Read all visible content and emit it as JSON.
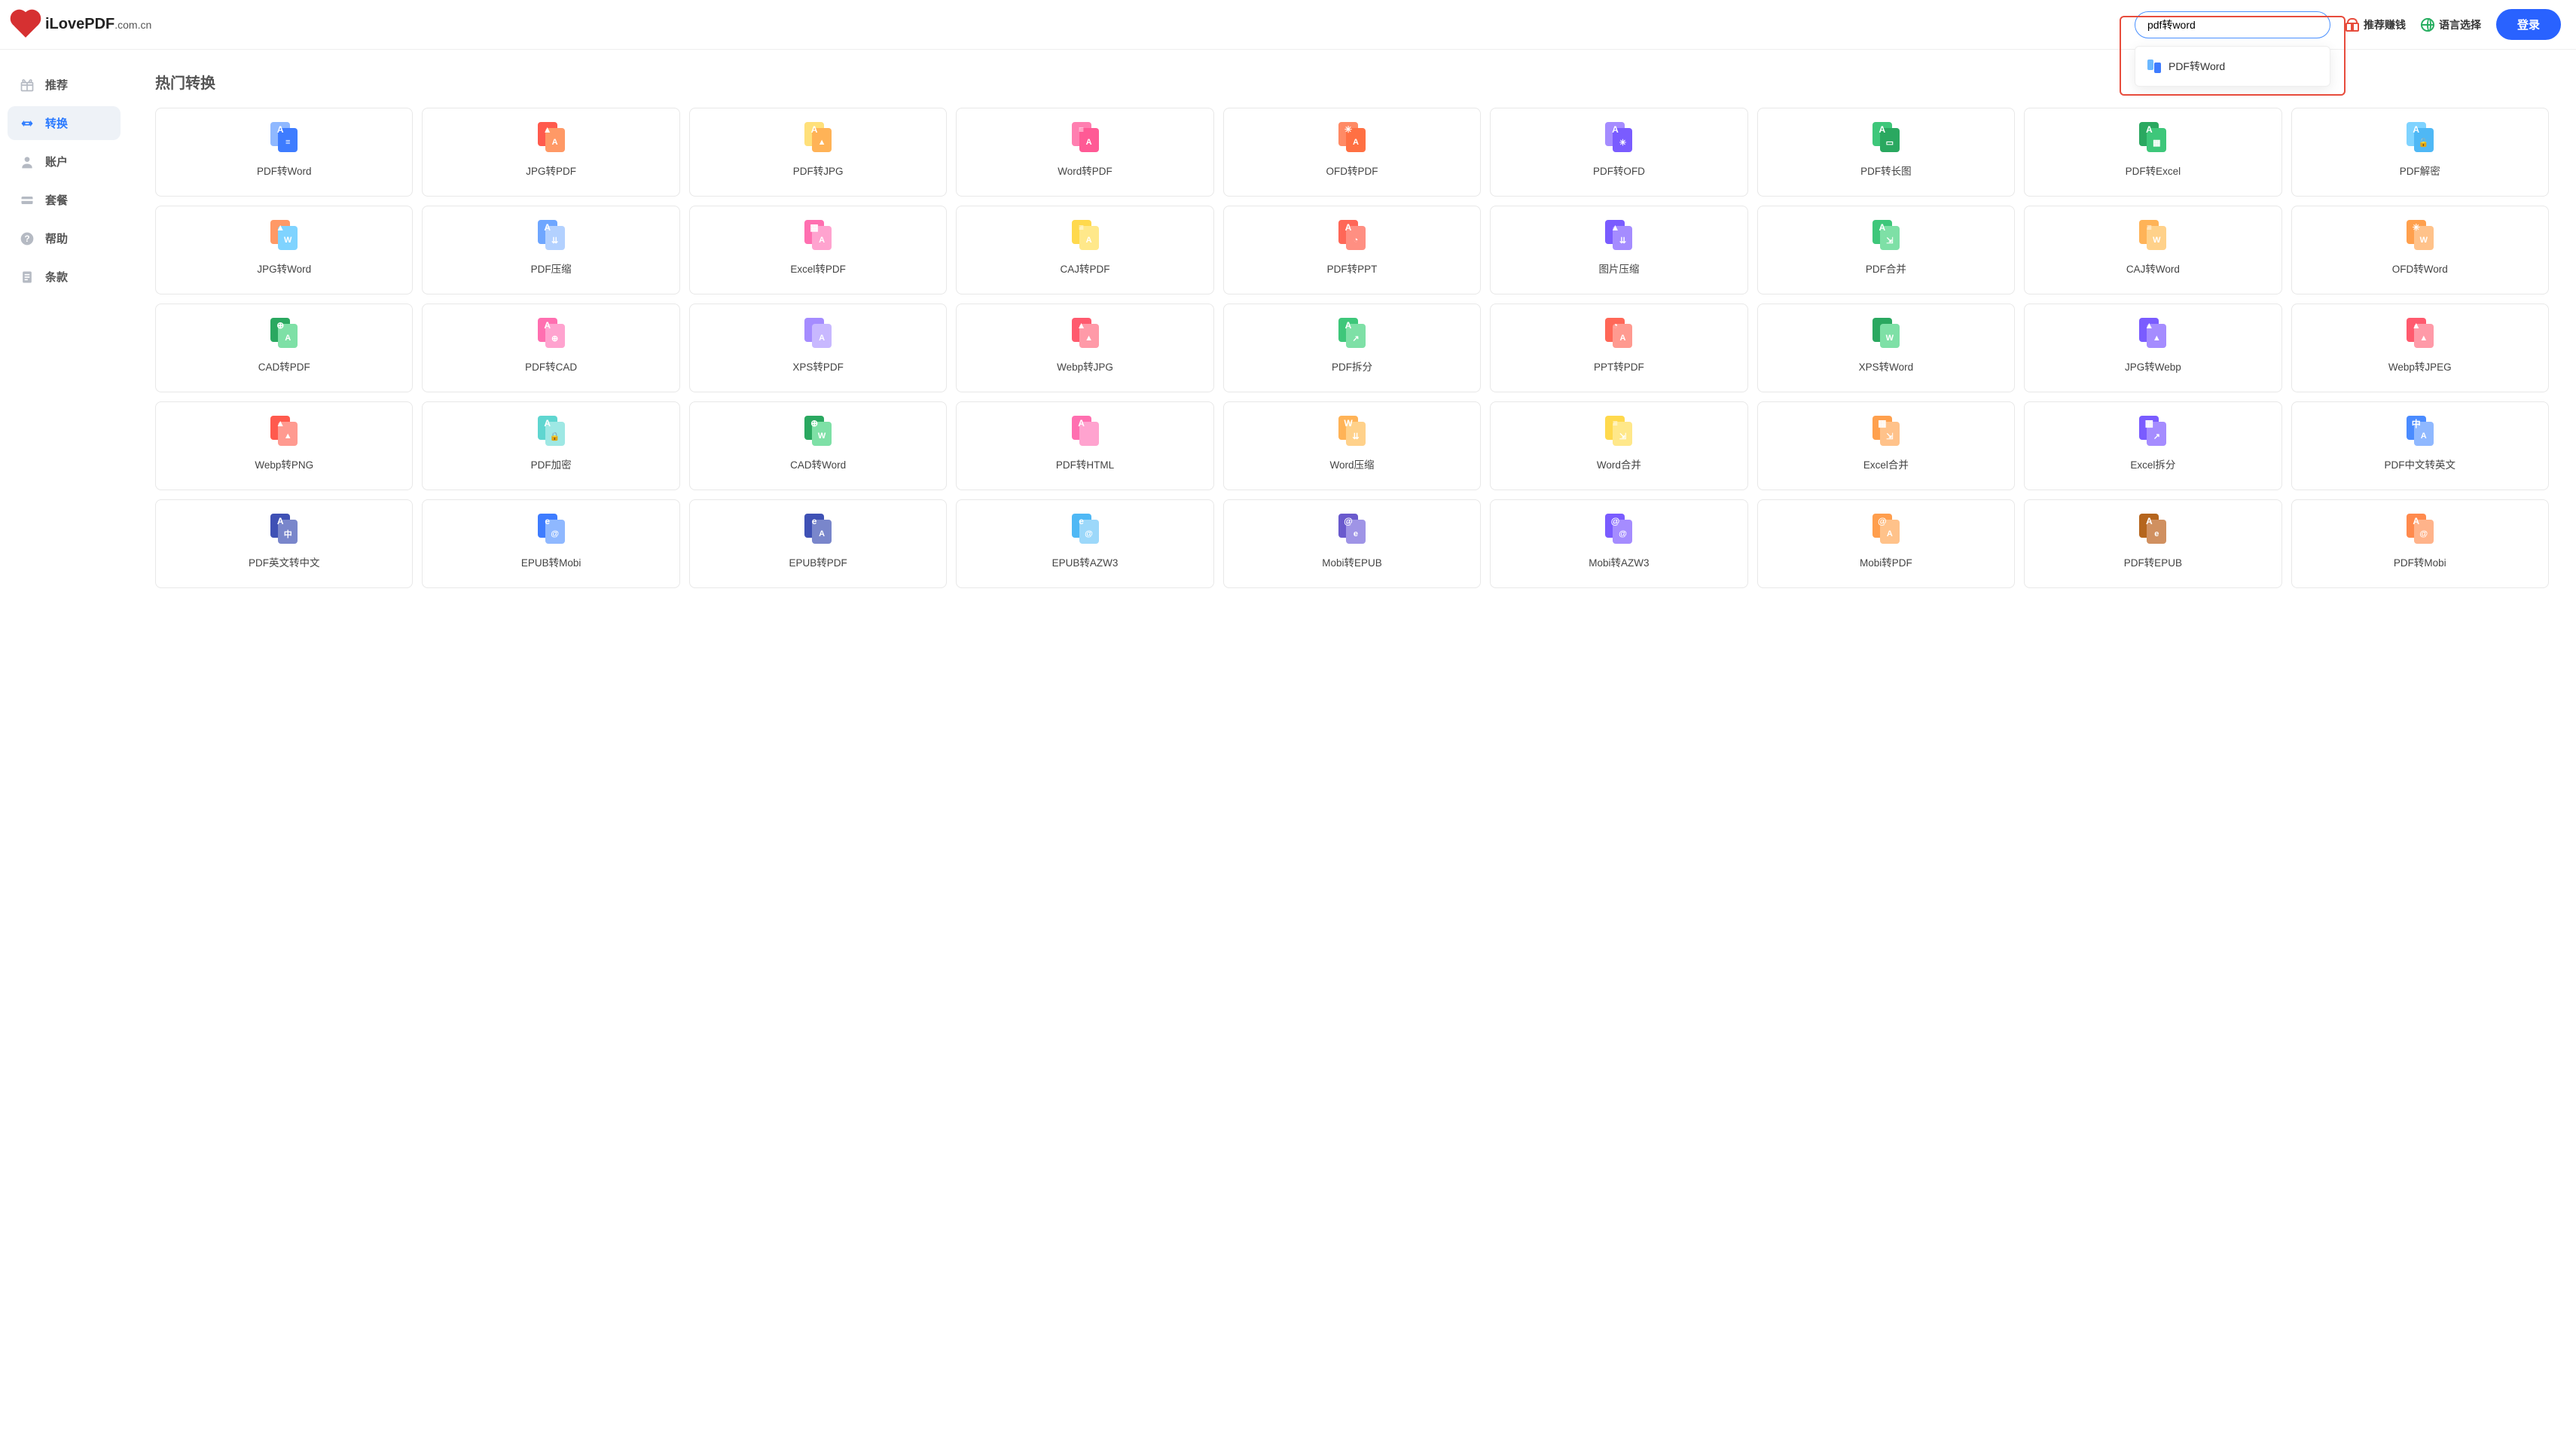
{
  "brand": {
    "name": "iLovePDF",
    "tld": ".com.cn"
  },
  "search": {
    "value": "pdf转word",
    "placeholder": "",
    "suggestion": "PDF转Word"
  },
  "header_links": {
    "recommend_earn": "推荐赚钱",
    "language": "语言选择",
    "login": "登录"
  },
  "sidebar": {
    "items": [
      {
        "label": "推荐",
        "icon": "gift"
      },
      {
        "label": "转换",
        "icon": "swap",
        "active": true
      },
      {
        "label": "账户",
        "icon": "user"
      },
      {
        "label": "套餐",
        "icon": "card"
      },
      {
        "label": "帮助",
        "icon": "help"
      },
      {
        "label": "条款",
        "icon": "doc"
      }
    ]
  },
  "section_title": "热门转换",
  "tools": [
    {
      "label": "PDF转Word",
      "c1": "#8fb8ff",
      "c2": "#3e7cff",
      "g1": "A",
      "g2": "≡"
    },
    {
      "label": "JPG转PDF",
      "c1": "#ff5a4d",
      "c2": "#ff9966",
      "g1": "▲",
      "g2": "A"
    },
    {
      "label": "PDF转JPG",
      "c1": "#ffe07a",
      "c2": "#ffb357",
      "g1": "A",
      "g2": "▲"
    },
    {
      "label": "Word转PDF",
      "c1": "#ff7fb0",
      "c2": "#ff5a95",
      "g1": "≡",
      "g2": "A"
    },
    {
      "label": "OFD转PDF",
      "c1": "#ff8a65",
      "c2": "#ff7043",
      "g1": "✳",
      "g2": "A"
    },
    {
      "label": "PDF转OFD",
      "c1": "#a58cff",
      "c2": "#7a5cff",
      "g1": "A",
      "g2": "✳"
    },
    {
      "label": "PDF转长图",
      "c1": "#3ec77a",
      "c2": "#2aa860",
      "g1": "A",
      "g2": "▭"
    },
    {
      "label": "PDF转Excel",
      "c1": "#2aa860",
      "c2": "#3ec77a",
      "g1": "A",
      "g2": "▦"
    },
    {
      "label": "PDF解密",
      "c1": "#7fd3ff",
      "c2": "#4fb8f5",
      "g1": "A",
      "g2": "🔓"
    },
    {
      "label": "JPG转Word",
      "c1": "#ff9966",
      "c2": "#7fd3ff",
      "g1": "▲",
      "g2": "W"
    },
    {
      "label": "PDF压缩",
      "c1": "#6ea6ff",
      "c2": "#b3d1ff",
      "g1": "A",
      "g2": "⇊"
    },
    {
      "label": "Excel转PDF",
      "c1": "#ff6fb0",
      "c2": "#ffa3cf",
      "g1": "▦",
      "g2": "A"
    },
    {
      "label": "CAJ转PDF",
      "c1": "#ffd94d",
      "c2": "#ffe88a",
      "g1": "≡",
      "g2": "A"
    },
    {
      "label": "PDF转PPT",
      "c1": "#ff6757",
      "c2": "#ff8f82",
      "g1": "A",
      "g2": "◔"
    },
    {
      "label": "图片压缩",
      "c1": "#7a5cff",
      "c2": "#a58cff",
      "g1": "▲",
      "g2": "⇊"
    },
    {
      "label": "PDF合并",
      "c1": "#3ec77a",
      "c2": "#7ee0a6",
      "g1": "A",
      "g2": "⇲"
    },
    {
      "label": "CAJ转Word",
      "c1": "#ffb357",
      "c2": "#ffd18a",
      "g1": "≡",
      "g2": "W"
    },
    {
      "label": "OFD转Word",
      "c1": "#ffa04d",
      "c2": "#ffc28a",
      "g1": "✳",
      "g2": "W"
    },
    {
      "label": "CAD转PDF",
      "c1": "#2aa860",
      "c2": "#7ee0a6",
      "g1": "⊕",
      "g2": "A"
    },
    {
      "label": "PDF转CAD",
      "c1": "#ff6fb0",
      "c2": "#ffa3cf",
      "g1": "A",
      "g2": "⊕"
    },
    {
      "label": "XPS转PDF",
      "c1": "#a58cff",
      "c2": "#c8b8ff",
      "g1": "</>",
      "g2": "A"
    },
    {
      "label": "Webp转JPG",
      "c1": "#ff5a6e",
      "c2": "#ff9aa8",
      "g1": "▲",
      "g2": "▲"
    },
    {
      "label": "PDF拆分",
      "c1": "#3ec77a",
      "c2": "#7ee0a6",
      "g1": "A",
      "g2": "↗"
    },
    {
      "label": "PPT转PDF",
      "c1": "#ff6757",
      "c2": "#ff9a90",
      "g1": "◔",
      "g2": "A"
    },
    {
      "label": "XPS转Word",
      "c1": "#2aa860",
      "c2": "#7ee0a6",
      "g1": "</>",
      "g2": "W"
    },
    {
      "label": "JPG转Webp",
      "c1": "#7a5cff",
      "c2": "#a58cff",
      "g1": "▲",
      "g2": "▲"
    },
    {
      "label": "Webp转JPEG",
      "c1": "#ff5a6e",
      "c2": "#ff9aa8",
      "g1": "▲",
      "g2": "▲"
    },
    {
      "label": "Webp转PNG",
      "c1": "#ff5a4d",
      "c2": "#ff9a90",
      "g1": "▲",
      "g2": "▲"
    },
    {
      "label": "PDF加密",
      "c1": "#5fd6d0",
      "c2": "#9ee8e4",
      "g1": "A",
      "g2": "🔒"
    },
    {
      "label": "CAD转Word",
      "c1": "#2aa860",
      "c2": "#7ee0a6",
      "g1": "⊕",
      "g2": "W"
    },
    {
      "label": "PDF转HTML",
      "c1": "#ff6fb0",
      "c2": "#ffa3cf",
      "g1": "A",
      "g2": "</>"
    },
    {
      "label": "Word压缩",
      "c1": "#ffb357",
      "c2": "#ffd18a",
      "g1": "W",
      "g2": "⇊"
    },
    {
      "label": "Word合并",
      "c1": "#ffd94d",
      "c2": "#ffe88a",
      "g1": "≡",
      "g2": "⇲"
    },
    {
      "label": "Excel合并",
      "c1": "#ffa04d",
      "c2": "#ffc28a",
      "g1": "▦",
      "g2": "⇲"
    },
    {
      "label": "Excel拆分",
      "c1": "#7a5cff",
      "c2": "#a58cff",
      "g1": "▦",
      "g2": "↗"
    },
    {
      "label": "PDF中文转英文",
      "c1": "#4a8bff",
      "c2": "#8fb8ff",
      "g1": "中",
      "g2": "A"
    },
    {
      "label": "PDF英文转中文",
      "c1": "#3f51b5",
      "c2": "#7986cb",
      "g1": "A",
      "g2": "中"
    },
    {
      "label": "EPUB转Mobi",
      "c1": "#3e7cff",
      "c2": "#8fb8ff",
      "g1": "e",
      "g2": "@"
    },
    {
      "label": "EPUB转PDF",
      "c1": "#3f51b5",
      "c2": "#7986cb",
      "g1": "e",
      "g2": "A"
    },
    {
      "label": "EPUB转AZW3",
      "c1": "#4fb8f5",
      "c2": "#9cd8fa",
      "g1": "e",
      "g2": "@"
    },
    {
      "label": "Mobi转EPUB",
      "c1": "#6a5acd",
      "c2": "#9f94e6",
      "g1": "@",
      "g2": "e"
    },
    {
      "label": "Mobi转AZW3",
      "c1": "#7a5cff",
      "c2": "#a58cff",
      "g1": "@",
      "g2": "@"
    },
    {
      "label": "Mobi转PDF",
      "c1": "#ff9e4d",
      "c2": "#ffc28a",
      "g1": "@",
      "g2": "A"
    },
    {
      "label": "PDF转EPUB",
      "c1": "#b5651d",
      "c2": "#d09060",
      "g1": "A",
      "g2": "e"
    },
    {
      "label": "PDF转Mobi",
      "c1": "#ff8a4d",
      "c2": "#ffb38a",
      "g1": "A",
      "g2": "@"
    }
  ]
}
